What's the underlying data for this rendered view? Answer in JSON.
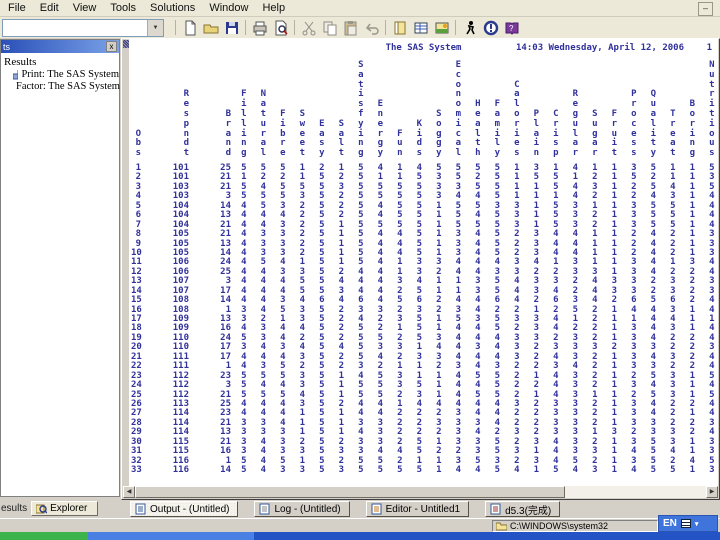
{
  "menu": {
    "items": [
      "File",
      "Edit",
      "View",
      "Tools",
      "Solutions",
      "Window",
      "Help"
    ],
    "minimize_glyph": "–"
  },
  "toolbar": {
    "combo_value": "",
    "icons": [
      "new-document",
      "open",
      "save",
      "print",
      "print-preview",
      "cut",
      "copy",
      "paste",
      "undo",
      "new-library",
      "query",
      "graphics",
      "submit",
      "break",
      "help"
    ]
  },
  "results_panel": {
    "title_visible": "ts",
    "close_glyph": "x",
    "root_label": "Results",
    "items": [
      {
        "label": "Print: The SAS System"
      },
      {
        "label": "Factor: The SAS System"
      }
    ]
  },
  "left_tabs": {
    "results_label": "esults",
    "explorer_label": "Explorer"
  },
  "output": {
    "title": "The SAS System",
    "datetime": "14:03 Wednesday, April 12, 2006",
    "page": "1",
    "text_color": "#31319c"
  },
  "chart_data": {
    "type": "table",
    "title": "The SAS System",
    "columns": [
      "Obs",
      "Respndt",
      "Brand",
      "Filling",
      "Natural",
      "Fibre",
      "Sweet",
      "Easy",
      "Salt",
      "Satisfying",
      "Energy",
      "Fun",
      "Kids",
      "Soggy",
      "Economical",
      "Health",
      "Family",
      "Calories",
      "Plain",
      "Crisp",
      "Regular",
      "Sugar",
      "Fruit",
      "Process",
      "Quality",
      "Treat",
      "Boring",
      "Nutritious"
    ],
    "rows": [
      [
        1,
        101,
        25,
        5,
        5,
        5,
        1,
        2,
        1,
        5,
        4,
        1,
        4,
        5,
        5,
        5,
        5,
        1,
        3,
        1,
        4,
        1,
        1,
        3,
        5,
        1,
        1,
        5
      ],
      [
        2,
        101,
        21,
        1,
        2,
        2,
        1,
        5,
        2,
        5,
        1,
        1,
        5,
        3,
        5,
        2,
        5,
        1,
        5,
        5,
        1,
        2,
        1,
        5,
        2,
        1,
        1,
        3
      ],
      [
        3,
        103,
        21,
        5,
        4,
        5,
        5,
        5,
        3,
        5,
        5,
        5,
        5,
        3,
        3,
        5,
        5,
        1,
        1,
        5,
        4,
        3,
        1,
        2,
        5,
        4,
        1,
        5
      ],
      [
        4,
        103,
        3,
        5,
        5,
        5,
        3,
        5,
        2,
        5,
        5,
        5,
        5,
        3,
        4,
        4,
        5,
        1,
        1,
        1,
        4,
        2,
        1,
        2,
        4,
        3,
        1,
        4
      ],
      [
        5,
        104,
        14,
        4,
        5,
        3,
        2,
        5,
        2,
        5,
        4,
        5,
        5,
        1,
        5,
        5,
        3,
        3,
        1,
        5,
        3,
        1,
        1,
        3,
        5,
        5,
        1,
        4
      ],
      [
        6,
        104,
        13,
        4,
        4,
        4,
        2,
        5,
        2,
        5,
        4,
        5,
        5,
        1,
        5,
        4,
        5,
        3,
        1,
        5,
        3,
        2,
        1,
        3,
        5,
        5,
        1,
        4
      ],
      [
        7,
        104,
        21,
        4,
        4,
        3,
        2,
        5,
        1,
        5,
        5,
        5,
        5,
        1,
        5,
        5,
        5,
        3,
        1,
        5,
        3,
        2,
        1,
        3,
        5,
        5,
        1,
        4
      ],
      [
        8,
        105,
        21,
        4,
        3,
        3,
        2,
        5,
        1,
        5,
        4,
        4,
        5,
        1,
        3,
        4,
        5,
        2,
        3,
        4,
        4,
        1,
        1,
        2,
        4,
        2,
        1,
        3
      ],
      [
        9,
        105,
        13,
        4,
        3,
        3,
        2,
        5,
        1,
        5,
        4,
        4,
        5,
        1,
        3,
        4,
        5,
        2,
        3,
        4,
        4,
        1,
        1,
        2,
        4,
        2,
        1,
        3
      ],
      [
        10,
        105,
        14,
        4,
        3,
        3,
        2,
        5,
        1,
        5,
        4,
        4,
        5,
        1,
        3,
        4,
        5,
        2,
        3,
        4,
        4,
        1,
        1,
        2,
        4,
        2,
        1,
        3
      ],
      [
        11,
        106,
        24,
        4,
        5,
        4,
        1,
        5,
        1,
        5,
        4,
        1,
        3,
        3,
        4,
        4,
        4,
        3,
        4,
        1,
        3,
        1,
        1,
        3,
        4,
        1,
        3,
        4
      ],
      [
        12,
        106,
        25,
        4,
        4,
        3,
        3,
        5,
        2,
        4,
        4,
        1,
        3,
        2,
        4,
        4,
        3,
        3,
        2,
        2,
        3,
        3,
        1,
        3,
        4,
        2,
        2,
        4
      ],
      [
        13,
        107,
        3,
        4,
        4,
        4,
        5,
        5,
        4,
        4,
        4,
        3,
        4,
        1,
        1,
        3,
        5,
        4,
        3,
        3,
        2,
        4,
        3,
        3,
        2,
        3,
        2,
        3
      ],
      [
        14,
        107,
        17,
        4,
        4,
        4,
        5,
        5,
        3,
        4,
        4,
        2,
        5,
        1,
        1,
        3,
        5,
        4,
        3,
        4,
        2,
        4,
        3,
        3,
        2,
        3,
        2,
        3
      ],
      [
        15,
        108,
        14,
        4,
        4,
        3,
        4,
        6,
        4,
        6,
        4,
        5,
        6,
        2,
        4,
        4,
        6,
        4,
        2,
        6,
        3,
        4,
        2,
        6,
        5,
        6,
        2,
        4
      ],
      [
        16,
        108,
        1,
        3,
        4,
        5,
        3,
        5,
        2,
        3,
        3,
        2,
        3,
        2,
        3,
        4,
        2,
        2,
        1,
        2,
        5,
        2,
        1,
        4,
        4,
        3,
        1,
        4
      ],
      [
        17,
        109,
        13,
        3,
        2,
        1,
        3,
        5,
        2,
        4,
        2,
        3,
        5,
        1,
        5,
        3,
        5,
        3,
        3,
        4,
        1,
        2,
        1,
        1,
        4,
        4,
        1,
        1
      ],
      [
        18,
        109,
        16,
        4,
        3,
        4,
        4,
        5,
        2,
        5,
        2,
        1,
        5,
        1,
        4,
        4,
        5,
        2,
        3,
        4,
        2,
        2,
        1,
        3,
        4,
        3,
        1,
        4
      ],
      [
        19,
        110,
        24,
        5,
        3,
        4,
        2,
        5,
        2,
        5,
        5,
        2,
        5,
        3,
        4,
        4,
        4,
        3,
        3,
        2,
        3,
        2,
        1,
        3,
        4,
        2,
        2,
        4
      ],
      [
        20,
        110,
        17,
        3,
        4,
        3,
        4,
        5,
        4,
        5,
        3,
        3,
        1,
        4,
        4,
        3,
        4,
        3,
        2,
        3,
        3,
        3,
        2,
        3,
        3,
        2,
        2,
        3
      ],
      [
        21,
        111,
        17,
        4,
        4,
        4,
        3,
        5,
        2,
        5,
        4,
        2,
        3,
        3,
        4,
        4,
        4,
        3,
        2,
        4,
        3,
        2,
        1,
        3,
        4,
        3,
        2,
        4
      ],
      [
        22,
        111,
        1,
        4,
        3,
        5,
        2,
        5,
        2,
        3,
        2,
        1,
        1,
        2,
        3,
        4,
        3,
        2,
        2,
        3,
        4,
        2,
        1,
        3,
        3,
        2,
        2,
        4
      ],
      [
        23,
        112,
        23,
        5,
        5,
        5,
        3,
        5,
        1,
        4,
        5,
        3,
        1,
        1,
        4,
        5,
        5,
        2,
        1,
        4,
        3,
        2,
        1,
        2,
        5,
        3,
        1,
        5
      ],
      [
        24,
        112,
        3,
        5,
        4,
        4,
        3,
        5,
        1,
        5,
        5,
        3,
        5,
        1,
        4,
        4,
        5,
        2,
        2,
        4,
        3,
        2,
        1,
        3,
        4,
        3,
        1,
        4
      ],
      [
        25,
        112,
        21,
        5,
        5,
        5,
        4,
        5,
        1,
        5,
        5,
        2,
        3,
        1,
        4,
        5,
        5,
        2,
        1,
        4,
        3,
        1,
        1,
        2,
        5,
        3,
        1,
        5
      ],
      [
        26,
        113,
        25,
        4,
        4,
        4,
        3,
        5,
        2,
        4,
        4,
        1,
        4,
        4,
        4,
        4,
        4,
        3,
        2,
        3,
        3,
        2,
        1,
        3,
        4,
        2,
        2,
        4
      ],
      [
        27,
        114,
        23,
        4,
        4,
        4,
        1,
        5,
        1,
        4,
        4,
        2,
        2,
        2,
        3,
        4,
        4,
        2,
        2,
        3,
        3,
        2,
        1,
        3,
        4,
        2,
        1,
        4
      ],
      [
        28,
        114,
        21,
        3,
        3,
        4,
        1,
        5,
        1,
        3,
        3,
        2,
        2,
        3,
        3,
        3,
        4,
        2,
        2,
        3,
        3,
        2,
        1,
        3,
        3,
        2,
        2,
        3
      ],
      [
        29,
        114,
        13,
        3,
        3,
        3,
        1,
        5,
        1,
        4,
        3,
        2,
        2,
        2,
        3,
        4,
        2,
        3,
        2,
        3,
        3,
        1,
        3,
        2,
        3,
        3,
        2,
        4
      ],
      [
        30,
        115,
        21,
        3,
        4,
        3,
        2,
        5,
        2,
        3,
        3,
        2,
        5,
        1,
        3,
        3,
        5,
        2,
        3,
        4,
        3,
        2,
        1,
        3,
        5,
        3,
        1,
        3
      ],
      [
        31,
        115,
        16,
        3,
        4,
        3,
        3,
        5,
        3,
        3,
        4,
        4,
        5,
        2,
        2,
        3,
        5,
        3,
        1,
        4,
        3,
        3,
        1,
        4,
        5,
        4,
        1,
        3
      ],
      [
        32,
        116,
        1,
        5,
        4,
        5,
        1,
        5,
        2,
        5,
        5,
        2,
        1,
        1,
        3,
        5,
        3,
        2,
        3,
        4,
        5,
        2,
        1,
        3,
        5,
        2,
        4,
        5
      ],
      [
        33,
        116,
        14,
        5,
        4,
        3,
        3,
        5,
        3,
        5,
        5,
        5,
        5,
        1,
        4,
        4,
        5,
        4,
        1,
        5,
        4,
        3,
        1,
        4,
        5,
        5,
        1,
        3
      ]
    ]
  },
  "window_bar": {
    "tabs": [
      {
        "label": "Output - (Untitled)",
        "active": true
      },
      {
        "label": "Log - (Untitled)",
        "active": false
      },
      {
        "label": "Editor - Untitled1",
        "active": false
      },
      {
        "label": "d5.3(完成)",
        "active": false
      }
    ]
  },
  "status_bar": {
    "path": "C:\\WINDOWS\\system32"
  },
  "language_bar": {
    "label": "EN"
  }
}
